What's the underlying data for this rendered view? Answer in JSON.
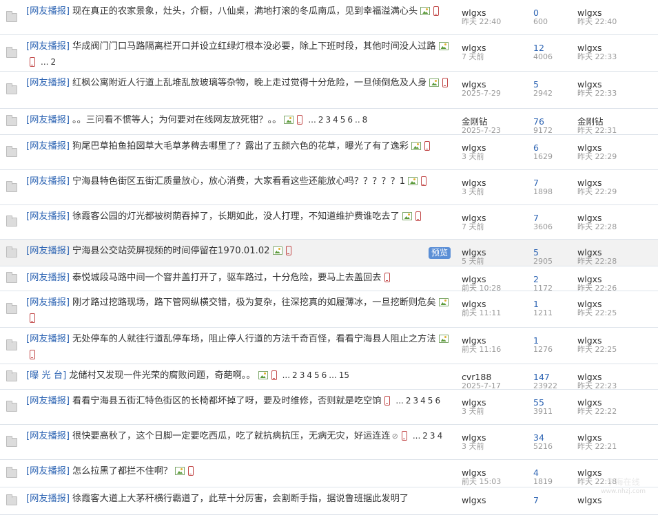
{
  "threads": [
    {
      "cat": "[网友播报]",
      "title": "现在真正的农家景象，灶头，介橱，八仙桌，满地打滚的冬瓜南瓜，见到幸福溢满心头",
      "img": true,
      "phone": true,
      "pages": [],
      "author": "wlgxs",
      "posted": "昨天 22:40",
      "replies": "0",
      "views": "600",
      "last_user": "wlgxs",
      "last_time": "昨天 22:40"
    },
    {
      "cat": "[网友播报]",
      "title": "华成阀门门口马路隔离栏开口并设立红绿灯根本没必要，除上下班时段，其他时间没人过路",
      "img": true,
      "phone": true,
      "pages": [
        "...",
        "2"
      ],
      "author": "wlgxs",
      "posted": "7 天前",
      "replies": "12",
      "views": "4006",
      "last_user": "wlgxs",
      "last_time": "昨天 22:33"
    },
    {
      "cat": "[网友播报]",
      "title": "红枫公寓附近人行道上乱堆乱放玻璃等杂物，晚上走过觉得十分危险，一旦倾倒危及人身",
      "img": true,
      "phone": true,
      "pages": [],
      "author": "wlgxs",
      "posted": "2025-7-29",
      "replies": "5",
      "views": "2942",
      "last_user": "wlgxs",
      "last_time": "昨天 22:33"
    },
    {
      "cat": "[网友播报]",
      "title": "。。三问看不惯等人；为何要对在线网友放死钳？。。",
      "img": true,
      "phone": true,
      "pages": [
        "...",
        "2",
        "3",
        "4",
        "5",
        "6",
        "..",
        "8"
      ],
      "author": "金刚钻",
      "posted": "2025-7-23",
      "replies": "76",
      "views": "9172",
      "last_user": "金刚钻",
      "last_time": "昨天 22:31"
    },
    {
      "cat": "[网友播报]",
      "title": "狗尾巴草拍鱼拍図草大毛草茅稗去哪里了？露出了五颜六色的花草，曝光了有了逸彩",
      "img": true,
      "phone": true,
      "pages": [],
      "author": "wlgxs",
      "posted": "3 天前",
      "replies": "6",
      "views": "1629",
      "last_user": "wlgxs",
      "last_time": "昨天 22:29"
    },
    {
      "cat": "[网友播报]",
      "title": "宁海县特色街区五街汇质量放心，放心消费，大家看看这些还能放心吗？？？？？1",
      "img": true,
      "phone": true,
      "pages": [],
      "author": "wlgxs",
      "posted": "3 天前",
      "replies": "7",
      "views": "1898",
      "last_user": "wlgxs",
      "last_time": "昨天 22:29"
    },
    {
      "cat": "[网友播报]",
      "title": "徐霞客公园的灯光都被树荫吞掉了，长期如此，没人打理，不知道维护费谁吃去了",
      "img": true,
      "phone": true,
      "pages": [],
      "author": "wlgxs",
      "posted": "7 天前",
      "replies": "7",
      "views": "3606",
      "last_user": "wlgxs",
      "last_time": "昨天 22:28"
    },
    {
      "cat": "[网友播报]",
      "title": "宁海县公交站荧屏视频的时间停留在1970.01.02",
      "img": true,
      "phone": true,
      "pages": [],
      "author": "wlgxs",
      "posted": "5 天前",
      "replies": "5",
      "views": "2905",
      "last_user": "wlgxs",
      "last_time": "昨天 22:28",
      "preview": "预览"
    },
    {
      "cat": "[网友播报]",
      "title": "泰悦城段马路中间一个窨井盖打开了，驱车路过，十分危险，要马上去盖回去",
      "img": false,
      "phone": true,
      "pages": [],
      "author": "wlgxs",
      "posted": "前天 10:28",
      "replies": "2",
      "views": "1172",
      "last_user": "wlgxs",
      "last_time": "昨天 22:26"
    },
    {
      "cat": "[网友播报]",
      "title": "刚才路过挖路现场，路下管网纵横交错，极为复杂，往深挖真的如履薄冰，一旦挖断则危矣",
      "img": true,
      "phone": true,
      "pages": [],
      "author": "wlgxs",
      "posted": "前天 11:11",
      "replies": "1",
      "views": "1211",
      "last_user": "wlgxs",
      "last_time": "昨天 22:25"
    },
    {
      "cat": "[网友播报]",
      "title": "无处停车的人就往行道乱停车场，阻止停人行道的方法千奇百怪，看看宁海县人阻止之方法",
      "img": true,
      "phone": true,
      "pages": [],
      "author": "wlgxs",
      "posted": "前天 11:16",
      "replies": "1",
      "views": "1276",
      "last_user": "wlgxs",
      "last_time": "昨天 22:25"
    },
    {
      "cat": "[曝 光 台]",
      "title": "龙储村又发现一件光荣的腐败问题，奇葩啊。。",
      "img": true,
      "phone": true,
      "pages": [
        "...",
        "2",
        "3",
        "4",
        "5",
        "6",
        "...",
        "15"
      ],
      "author": "cvr188",
      "posted": "2025-7-17",
      "replies": "147",
      "views": "23922",
      "last_user": "wlgxs",
      "last_time": "昨天 22:23"
    },
    {
      "cat": "[网友播报]",
      "title": "看看宁海县五街汇特色街区的长椅都坏掉了呀，要及时维修，否则就是吃空饷",
      "img": false,
      "phone": true,
      "pages": [
        "...",
        "2",
        "3",
        "4",
        "5",
        "6"
      ],
      "author": "wlgxs",
      "posted": "3 天前",
      "replies": "55",
      "views": "3911",
      "last_user": "wlgxs",
      "last_time": "昨天 22:22"
    },
    {
      "cat": "[网友播报]",
      "title": "很快要高秋了，这个日脚一定要吃西瓜，吃了就抗病抗压，无病无灾，好运连连",
      "img": false,
      "clip": true,
      "phone": true,
      "pages": [
        "...",
        "2",
        "3",
        "4"
      ],
      "author": "wlgxs",
      "posted": "3 天前",
      "replies": "34",
      "views": "5216",
      "last_user": "wlgxs",
      "last_time": "昨天 22:21"
    },
    {
      "cat": "[网友播报]",
      "title": "怎么拉黑了都拦不住啊？",
      "img": true,
      "phone": true,
      "pages": [],
      "author": "wlgxs",
      "posted": "前天 15:03",
      "replies": "4",
      "views": "1819",
      "last_user": "wlgxs",
      "last_time": "昨天 22:18"
    },
    {
      "cat": "[网友播报]",
      "title": "徐霞客大道上大茅秆横行霸道了，此草十分厉害，会割断手指，据说鲁班据此发明了",
      "img": false,
      "phone": false,
      "pages": [],
      "author": "wlgxs",
      "posted": "",
      "replies": "7",
      "views": "",
      "last_user": "wlgxs",
      "last_time": ""
    }
  ],
  "watermark": {
    "brand": "宁海在线",
    "url": "www.nhzj.com"
  }
}
